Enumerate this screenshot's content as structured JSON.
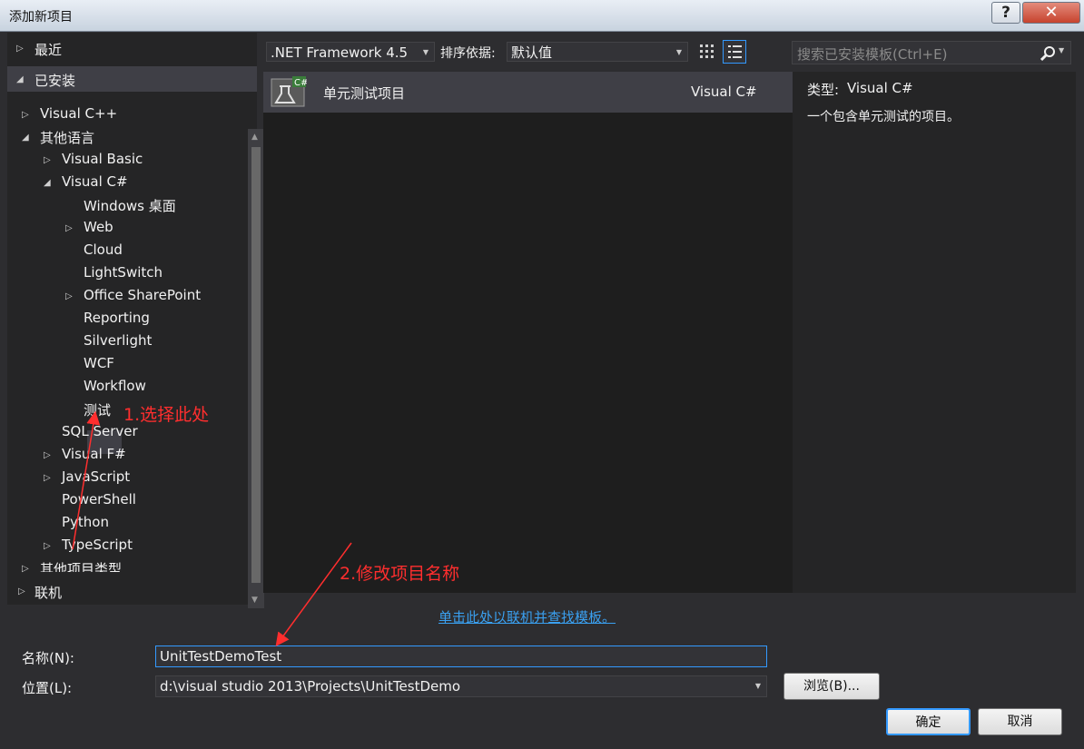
{
  "window": {
    "title": "添加新项目",
    "help_label": "?",
    "close_label": "✕"
  },
  "left_panel": {
    "recent_label": "最近",
    "installed_label": "已安装",
    "online_label": "联机",
    "tree": [
      {
        "label": "Visual C++",
        "expander": "closed"
      },
      {
        "label": "其他语言",
        "expander": "open"
      },
      {
        "label": "Visual Basic",
        "expander": "closed"
      },
      {
        "label": "Visual C#",
        "expander": "open"
      },
      {
        "label": "Windows 桌面",
        "expander": "none"
      },
      {
        "label": "Web",
        "expander": "closed"
      },
      {
        "label": "Cloud",
        "expander": "none"
      },
      {
        "label": "LightSwitch",
        "expander": "none"
      },
      {
        "label": "Office SharePoint",
        "expander": "closed"
      },
      {
        "label": "Reporting",
        "expander": "none"
      },
      {
        "label": "Silverlight",
        "expander": "none"
      },
      {
        "label": "WCF",
        "expander": "none"
      },
      {
        "label": "Workflow",
        "expander": "none"
      },
      {
        "label": "测试",
        "expander": "none",
        "selected": true
      },
      {
        "label": "SQL Server",
        "expander": "none"
      },
      {
        "label": "Visual F#",
        "expander": "closed"
      },
      {
        "label": "JavaScript",
        "expander": "closed"
      },
      {
        "label": "PowerShell",
        "expander": "none"
      },
      {
        "label": "Python",
        "expander": "none"
      },
      {
        "label": "TypeScript",
        "expander": "closed"
      },
      {
        "label": "其他项目类型",
        "expander": "closed"
      }
    ]
  },
  "toolbar": {
    "framework": ".NET Framework 4.5",
    "sort_label": "排序依据:",
    "sort_value": "默认值",
    "search_placeholder": "搜索已安装模板(Ctrl+E)"
  },
  "templates": [
    {
      "name": "单元测试项目",
      "language": "Visual C#",
      "icon": "test-project-icon",
      "selected": true
    }
  ],
  "details": {
    "type_label": "类型:",
    "type_value": "Visual C#",
    "description": "一个包含单元测试的项目。"
  },
  "online_link": "单击此处以联机并查找模板。",
  "form": {
    "name_label": "名称(N):",
    "name_value": "UnitTestDemoTest",
    "location_label": "位置(L):",
    "location_value": "d:\\visual studio 2013\\Projects\\UnitTestDemo",
    "browse_label": "浏览(B)...",
    "ok_label": "确定",
    "cancel_label": "取消"
  },
  "annotations": {
    "step1": "1.选择此处",
    "step2": "2.修改项目名称",
    "color": "#ff2e2e"
  },
  "colors": {
    "background": "#2d2d30",
    "panel": "#252526",
    "selection": "#3f3f46",
    "link": "#3aa0f0"
  }
}
